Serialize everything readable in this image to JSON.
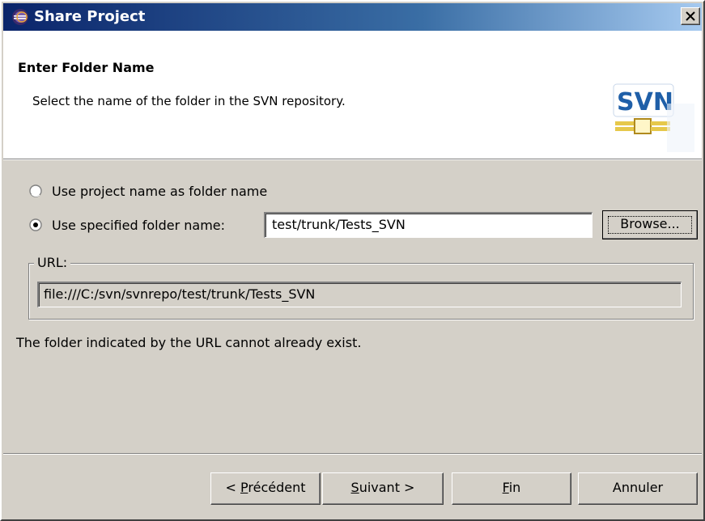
{
  "window": {
    "title": "Share Project",
    "icon": "eclipse-icon"
  },
  "banner": {
    "title": "Enter Folder Name",
    "description": "Select the name of the folder in the SVN repository.",
    "logo_text": "SVN"
  },
  "options": {
    "use_project_name_label": "Use project name as folder name",
    "use_project_name_selected": false,
    "use_specified_label": "Use specified folder name:",
    "use_specified_selected": true,
    "folder_name_value": "test/trunk/Tests_SVN",
    "browse_label": "Browse..."
  },
  "url_group": {
    "legend": "URL:",
    "value": "file:///C:/svn/svnrepo/test/trunk/Tests_SVN"
  },
  "info": {
    "message": "The folder indicated by the URL cannot already exist."
  },
  "buttons": {
    "prev_prefix": "< ",
    "prev_mnemonic": "P",
    "prev_rest": "récédent",
    "next_mnemonic": "S",
    "next_rest": "uivant >",
    "finish_mnemonic": "F",
    "finish_rest": "in",
    "cancel_label": "Annuler"
  },
  "colors": {
    "titlebar_start": "#0a246a",
    "titlebar_end": "#a6caf0",
    "dialog_bg": "#d4d0c8",
    "svn_blue": "#1f5fa8",
    "svn_gold": "#e6c84b"
  }
}
